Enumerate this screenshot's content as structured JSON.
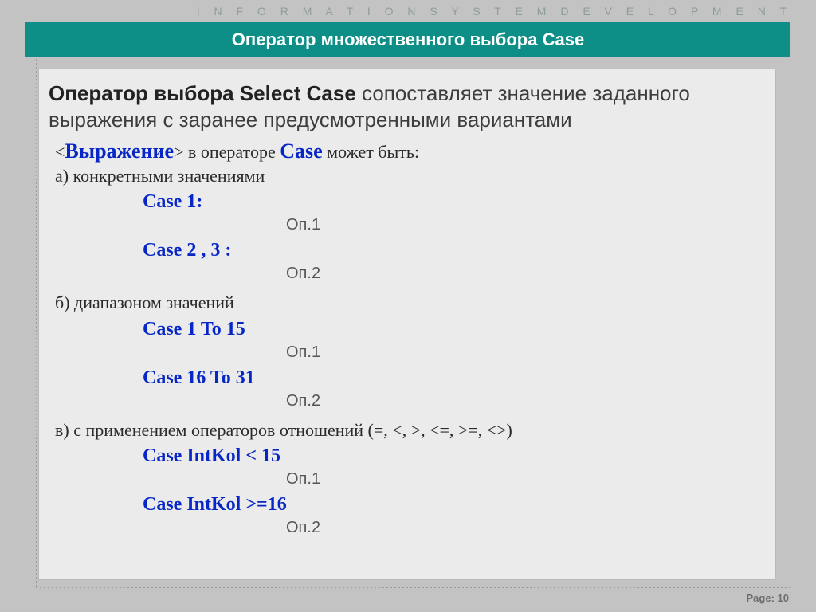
{
  "header": {
    "banner": "I N F O R M A T I O N   S Y S T E M   D E V E L O P M E N T",
    "title": "Оператор множественного выбора Case"
  },
  "intro": {
    "bold": "Оператор выбора Select Case",
    "rest": " сопоставляет значение заданного выражения с заранее предусмотренными вариантами"
  },
  "line1": {
    "lt": "<",
    "expr": "Выражение",
    "gt": ">",
    "mid": " в операторе ",
    "case": "Case",
    "tail": " может быть:"
  },
  "sectA": {
    "label": "а) конкретными значениями",
    "case1": "Case 1:",
    "op1": "Оп.1",
    "case2": "Case 2 , 3 :",
    "op2": "Оп.2"
  },
  "sectB": {
    "label": "б) диапазоном значений",
    "case1": "Case 1 To 15",
    "op1": "Оп.1",
    "case2": "Case 16 To 31",
    "op2": "Оп.2"
  },
  "sectC": {
    "label": "в) с применением операторов  отношений (=, <, >, <=, >=, <>)",
    "case1": "Case IntKol < 15",
    "op1": "Оп.1",
    "case2": "Case IntKol >=16",
    "op2": "Оп.2"
  },
  "footer": {
    "page_label": "Page:",
    "page_no": "10"
  }
}
